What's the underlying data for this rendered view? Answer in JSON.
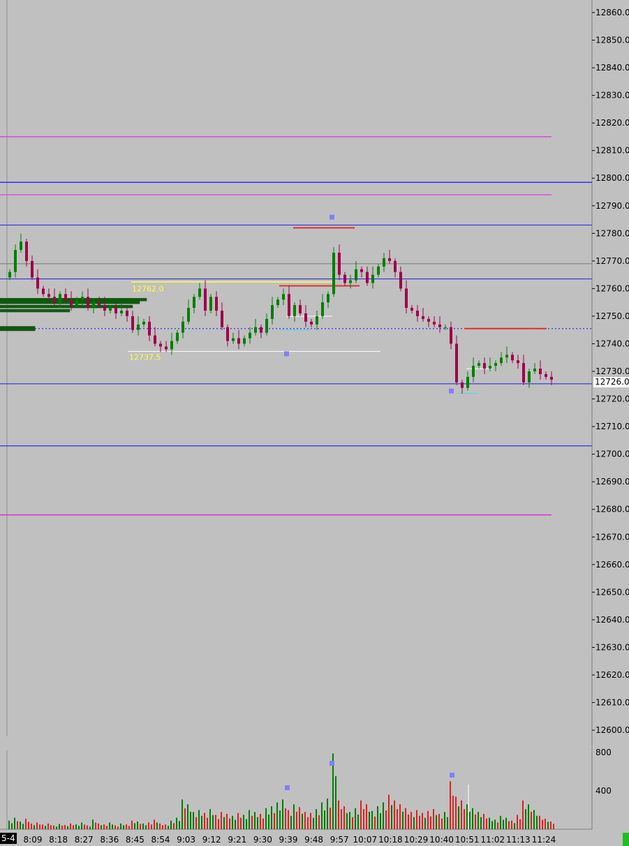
{
  "chart_data": {
    "type": "candlestick",
    "price_axis": {
      "min": 12600,
      "max": 12860,
      "step": 10,
      "ticks": [
        "12860.0",
        "12850.0",
        "12840.0",
        "12830.0",
        "12820.0",
        "12810.0",
        "12800.0",
        "12790.0",
        "12780.0",
        "12770.0",
        "12760.0",
        "12750.0",
        "12740.0",
        "12730.0",
        "12720.0",
        "12710.0",
        "12700.0",
        "12690.0",
        "12680.0",
        "12670.0",
        "12660.0",
        "12650.0",
        "12640.0",
        "12630.0",
        "12620.0",
        "12610.0",
        "12600.0"
      ]
    },
    "current_price": "12726.0",
    "time_axis": {
      "start_label": "5-4",
      "ticks": [
        "8:09",
        "8:18",
        "8:27",
        "8:36",
        "8:45",
        "8:54",
        "9:03",
        "9:12",
        "9:21",
        "9:30",
        "9:39",
        "9:48",
        "9:57",
        "10:07",
        "10:18",
        "10:29",
        "10:40",
        "10:51",
        "11:02",
        "11:13",
        "11:24"
      ]
    },
    "bar_minutes": 2,
    "open": 12764,
    "closes": [
      12766,
      12774,
      12777,
      12770,
      12764,
      12760,
      12758,
      12757,
      12755,
      12758,
      12756,
      12754,
      12756,
      12757,
      12753,
      12755,
      12754,
      12752,
      12753,
      12751,
      12752,
      12750,
      12745,
      12747,
      12748,
      12743,
      12740,
      12739,
      12738,
      12741,
      12744,
      12748,
      12753,
      12757,
      12760,
      12752,
      12757,
      12752,
      12746,
      12741,
      12742,
      12740,
      12742,
      12744,
      12746,
      12744,
      12749,
      12754,
      12756,
      12758,
      12750,
      12754,
      12751,
      12748,
      12747,
      12750,
      12755,
      12758,
      12773,
      12765,
      12762,
      12763,
      12767,
      12766,
      12762,
      12765,
      12768,
      12771,
      12770,
      12766,
      12760,
      12753,
      12752,
      12750,
      12749,
      12748,
      12747,
      12746,
      12746,
      12740,
      12726,
      12724,
      12728,
      12732,
      12733,
      12731,
      12732,
      12733,
      12735,
      12736,
      12734,
      12733,
      12726,
      12730,
      12731,
      12729,
      12728,
      12727
    ],
    "volume_axis": {
      "ticks": [
        "800",
        "400"
      ]
    },
    "volumes": [
      90,
      120,
      80,
      110,
      60,
      70,
      50,
      60,
      40,
      55,
      45,
      60,
      50,
      70,
      40,
      100,
      60,
      50,
      70,
      40,
      60,
      50,
      90,
      80,
      60,
      70,
      100,
      60,
      50,
      90,
      120,
      310,
      260,
      180,
      200,
      170,
      210,
      150,
      180,
      160,
      140,
      170,
      150,
      200,
      180,
      160,
      220,
      240,
      280,
      310,
      200,
      260,
      230,
      180,
      170,
      210,
      280,
      320,
      790,
      300,
      240,
      180,
      220,
      300,
      260,
      190,
      240,
      280,
      360,
      300,
      260,
      220,
      180,
      200,
      170,
      190,
      210,
      160,
      180,
      500,
      340,
      300,
      260,
      220,
      180,
      160,
      120,
      100,
      140,
      120,
      90,
      150,
      300,
      260,
      200,
      140,
      110,
      80
    ],
    "levels": [
      {
        "price": 12815,
        "color": "#e020e0",
        "style": "solid"
      },
      {
        "price": 12798.5,
        "color": "#0000ff",
        "style": "solid"
      },
      {
        "price": 12794,
        "color": "#e040e0",
        "style": "solid"
      },
      {
        "price": 12783,
        "color": "#3030e0",
        "style": "solid"
      },
      {
        "price": 12769,
        "color": "#808080",
        "style": "solid"
      },
      {
        "price": 12763.5,
        "color": "#3030e0",
        "style": "solid"
      },
      {
        "price": 12745.5,
        "color": "#3030ff",
        "style": "dotted"
      },
      {
        "price": 12725.5,
        "color": "#3030e0",
        "style": "solid"
      },
      {
        "price": 12703,
        "color": "#3030e0",
        "style": "solid"
      },
      {
        "price": 12678,
        "color": "#d020d0",
        "style": "solid"
      }
    ],
    "annotations": [
      {
        "text": "12762.0",
        "price": 12762,
        "color": "#ffff40"
      },
      {
        "text": "12737.5",
        "price": 12737.5,
        "color": "#ffff40"
      }
    ],
    "colors": {
      "up": "#008000",
      "down": "#a0004a",
      "vol_up": "#008000",
      "vol_down": "#e02020",
      "marker": "#8080ff"
    }
  }
}
